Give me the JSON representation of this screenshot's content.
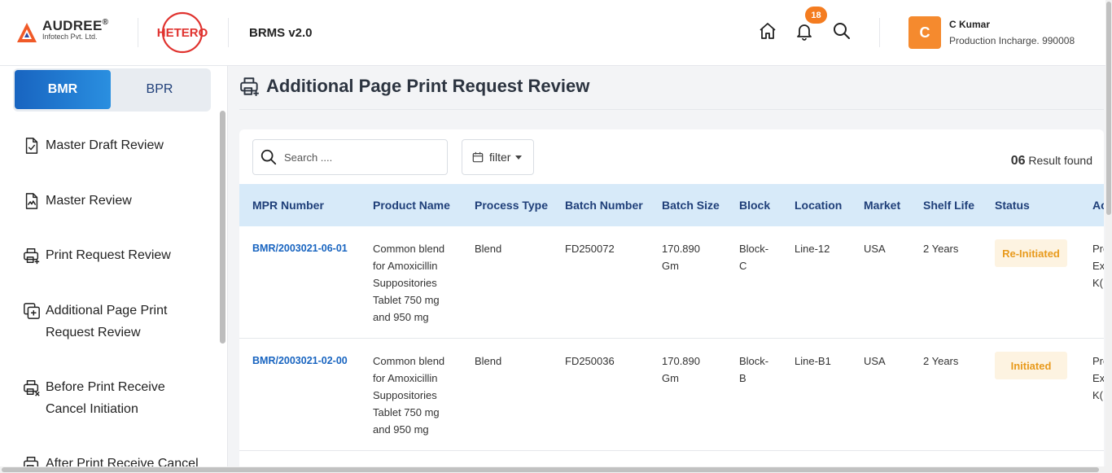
{
  "header": {
    "logo_name": "AUDREE",
    "logo_reg": "®",
    "logo_sub": "Infotech Pvt. Ltd.",
    "partner_logo": "HETERO",
    "app_title": "BRMS v2.0",
    "notification_count": "18",
    "user_initial": "C",
    "user_name": "C Kumar",
    "user_role": "Production Incharge. 990008",
    "icons": [
      "home-icon",
      "bell-icon",
      "search-icon"
    ]
  },
  "sidebar": {
    "segments": [
      {
        "label": "BMR",
        "active": true
      },
      {
        "label": "BPR",
        "active": false
      }
    ],
    "items": [
      {
        "label": "Master Draft Review",
        "icon": "document-check-icon"
      },
      {
        "label": "Master Review",
        "icon": "document-signature-icon"
      },
      {
        "label": "Print Request Review",
        "icon": "printer-plus-icon"
      },
      {
        "label": "Additional Page Print Request Review",
        "icon": "copy-plus-icon"
      },
      {
        "label": "Before Print Receive Cancel Initiation",
        "icon": "printer-x-icon"
      },
      {
        "label": "After Print Receive Cancel",
        "icon": "printer-icon"
      }
    ]
  },
  "main": {
    "page_title": "Additional Page Print Request Review",
    "search_placeholder": "Search ....",
    "filter_label": "filter",
    "result_count": "06",
    "result_suffix": "Result found",
    "columns": [
      "MPR Number",
      "Product Name",
      "Process Type",
      "Batch Number",
      "Batch Size",
      "Block",
      "Location",
      "Market",
      "Shelf Life",
      "Status",
      "Act"
    ],
    "rows": [
      {
        "mpr": "BMR/2003021-06-01",
        "product": "Common blend for Amoxicillin Suppositories Tablet 750 mg and 950 mg",
        "process": "Blend",
        "batch": "FD250072",
        "size": "170.890 Gm",
        "block": "Block-C",
        "location": "Line-12",
        "market": "USA",
        "shelf": "2 Years",
        "status": "Re-Initiated",
        "action": "Pro Exe K("
      },
      {
        "mpr": "BMR/2003021-02-00",
        "product": "Common blend for Amoxicillin Suppositories Tablet 750 mg and 950 mg",
        "process": "Blend",
        "batch": "FD250036",
        "size": "170.890 Gm",
        "block": "Block-B",
        "location": "Line-B1",
        "market": "USA",
        "shelf": "2 Years",
        "status": "Initiated",
        "action": "Pro Exe K("
      }
    ]
  }
}
